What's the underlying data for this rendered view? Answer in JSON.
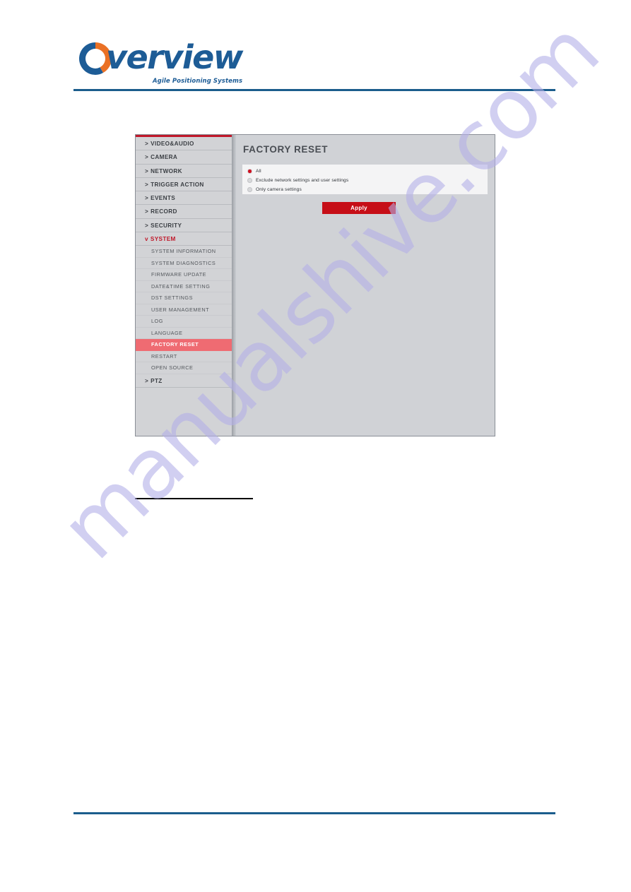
{
  "header": {
    "logo_text": "verview",
    "logo_tagline": "Agile Positioning Systems",
    "brand_blue": "#1d5c96",
    "brand_orange": "#ea7125",
    "rule_color": "#1b5d8c"
  },
  "watermark": {
    "text": "manualshive.com",
    "color": "#b4b0e8"
  },
  "ui": {
    "accent_red": "#c0182a",
    "active_item_bg": "#ef6b72",
    "sidebar": {
      "menu": [
        {
          "caret": ">",
          "label": "VIDEO&AUDIO",
          "expanded": false
        },
        {
          "caret": ">",
          "label": "CAMERA",
          "expanded": false
        },
        {
          "caret": ">",
          "label": "NETWORK",
          "expanded": false
        },
        {
          "caret": ">",
          "label": "TRIGGER ACTION",
          "expanded": false
        },
        {
          "caret": ">",
          "label": "EVENTS",
          "expanded": false
        },
        {
          "caret": ">",
          "label": "RECORD",
          "expanded": false
        },
        {
          "caret": ">",
          "label": "SECURITY",
          "expanded": false
        },
        {
          "caret": "v",
          "label": "SYSTEM",
          "expanded": true
        }
      ],
      "submenu": [
        {
          "label": "SYSTEM INFORMATION",
          "active": false
        },
        {
          "label": "SYSTEM DIAGNOSTICS",
          "active": false
        },
        {
          "label": "FIRMWARE UPDATE",
          "active": false
        },
        {
          "label": "DATE&TIME SETTING",
          "active": false
        },
        {
          "label": "DST SETTINGS",
          "active": false
        },
        {
          "label": "USER MANAGEMENT",
          "active": false
        },
        {
          "label": "LOG",
          "active": false
        },
        {
          "label": "LANGUAGE",
          "active": false
        },
        {
          "label": "FACTORY RESET",
          "active": true
        },
        {
          "label": "RESTART",
          "active": false
        },
        {
          "label": "OPEN SOURCE",
          "active": false
        }
      ],
      "menu_after": [
        {
          "caret": ">",
          "label": "PTZ",
          "expanded": false
        }
      ]
    },
    "content": {
      "title": "FACTORY RESET",
      "options": [
        {
          "label": "All",
          "checked": true
        },
        {
          "label": "Exclude network settings and user settings",
          "checked": false
        },
        {
          "label": "Only camera settings",
          "checked": false
        }
      ],
      "apply_label": "Apply"
    }
  }
}
